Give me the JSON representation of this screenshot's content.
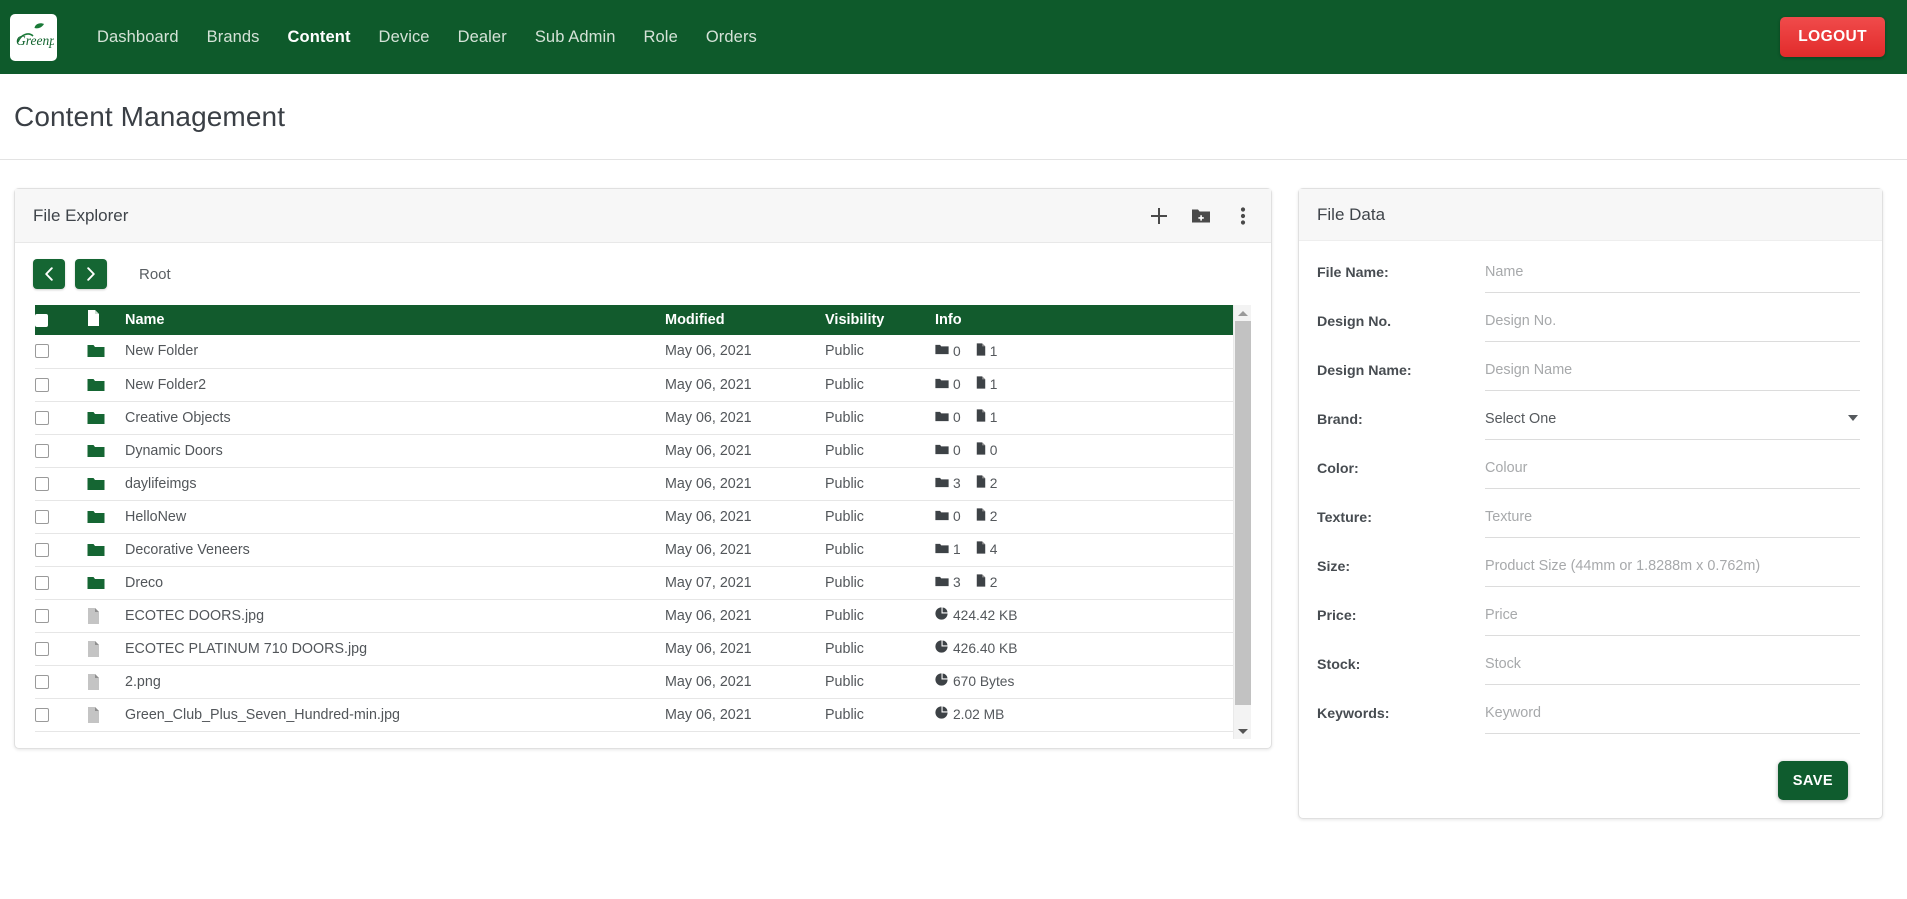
{
  "navbar": {
    "logo_alt": "Greenply",
    "links": [
      {
        "label": "Dashboard",
        "active": false
      },
      {
        "label": "Brands",
        "active": false
      },
      {
        "label": "Content",
        "active": true
      },
      {
        "label": "Device",
        "active": false
      },
      {
        "label": "Dealer",
        "active": false
      },
      {
        "label": "Sub Admin",
        "active": false
      },
      {
        "label": "Role",
        "active": false
      },
      {
        "label": "Orders",
        "active": false
      }
    ],
    "logout_label": "LOGOUT",
    "bg_color": "#0e5a2b",
    "logout_color": "#e22b2b"
  },
  "page": {
    "title": "Content Management"
  },
  "explorer": {
    "title": "File Explorer",
    "toolbar": {
      "add_label": "add-file",
      "new_folder_label": "create-new-folder",
      "more_label": "more-options"
    },
    "breadcrumb": {
      "back_label": "‹",
      "forward_label": "›",
      "path": "Root"
    },
    "columns": [
      "",
      "",
      "Name",
      "Modified",
      "Visibility",
      "Info"
    ],
    "rows": [
      {
        "type": "folder",
        "name": "New Folder",
        "modified": "May 06, 2021",
        "visibility": "Public",
        "folders": "0",
        "files": "1"
      },
      {
        "type": "folder",
        "name": "New Folder2",
        "modified": "May 06, 2021",
        "visibility": "Public",
        "folders": "0",
        "files": "1"
      },
      {
        "type": "folder",
        "name": "Creative Objects",
        "modified": "May 06, 2021",
        "visibility": "Public",
        "folders": "0",
        "files": "1"
      },
      {
        "type": "folder",
        "name": "Dynamic Doors",
        "modified": "May 06, 2021",
        "visibility": "Public",
        "folders": "0",
        "files": "0"
      },
      {
        "type": "folder",
        "name": "daylifeimgs",
        "modified": "May 06, 2021",
        "visibility": "Public",
        "folders": "3",
        "files": "2"
      },
      {
        "type": "folder",
        "name": "HelloNew",
        "modified": "May 06, 2021",
        "visibility": "Public",
        "folders": "0",
        "files": "2"
      },
      {
        "type": "folder",
        "name": "Decorative Veneers",
        "modified": "May 06, 2021",
        "visibility": "Public",
        "folders": "1",
        "files": "4"
      },
      {
        "type": "folder",
        "name": "Dreco",
        "modified": "May 07, 2021",
        "visibility": "Public",
        "folders": "3",
        "files": "2"
      },
      {
        "type": "file",
        "name": "ECOTEC DOORS.jpg",
        "modified": "May 06, 2021",
        "visibility": "Public",
        "size": "424.42 KB"
      },
      {
        "type": "file",
        "name": "ECOTEC PLATINUM 710 DOORS.jpg",
        "modified": "May 06, 2021",
        "visibility": "Public",
        "size": "426.40 KB"
      },
      {
        "type": "file",
        "name": "2.png",
        "modified": "May 06, 2021",
        "visibility": "Public",
        "size": "670 Bytes"
      },
      {
        "type": "file",
        "name": "Green_Club_Plus_Seven_Hundred-min.jpg",
        "modified": "May 06, 2021",
        "visibility": "Public",
        "size": "2.02 MB"
      }
    ]
  },
  "file_data": {
    "title": "File Data",
    "fields": [
      {
        "label": "File Name:",
        "placeholder": "Name",
        "value": "",
        "kind": "input",
        "name": "file-name"
      },
      {
        "label": "Design No.",
        "placeholder": "Design No.",
        "value": "",
        "kind": "input",
        "name": "design-no"
      },
      {
        "label": "Design Name:",
        "placeholder": "Design Name",
        "value": "",
        "kind": "input",
        "name": "design-name"
      },
      {
        "label": "Brand:",
        "placeholder": "",
        "value": "Select One",
        "kind": "select",
        "name": "brand"
      },
      {
        "label": "Color:",
        "placeholder": "Colour",
        "value": "",
        "kind": "input",
        "name": "color"
      },
      {
        "label": "Texture:",
        "placeholder": "Texture",
        "value": "",
        "kind": "input",
        "name": "texture"
      },
      {
        "label": "Size:",
        "placeholder": "Product Size (44mm or 1.8288m x 0.762m)",
        "value": "",
        "kind": "input",
        "name": "size"
      },
      {
        "label": "Price:",
        "placeholder": "Price",
        "value": "",
        "kind": "input",
        "name": "price"
      },
      {
        "label": "Stock:",
        "placeholder": "Stock",
        "value": "",
        "kind": "input",
        "name": "stock"
      },
      {
        "label": "Keywords:",
        "placeholder": "Keyword",
        "value": "",
        "kind": "input",
        "name": "keywords"
      }
    ],
    "brand_options": [
      "Select One"
    ],
    "save_label": "SAVE",
    "save_color": "#0f5c2e"
  }
}
